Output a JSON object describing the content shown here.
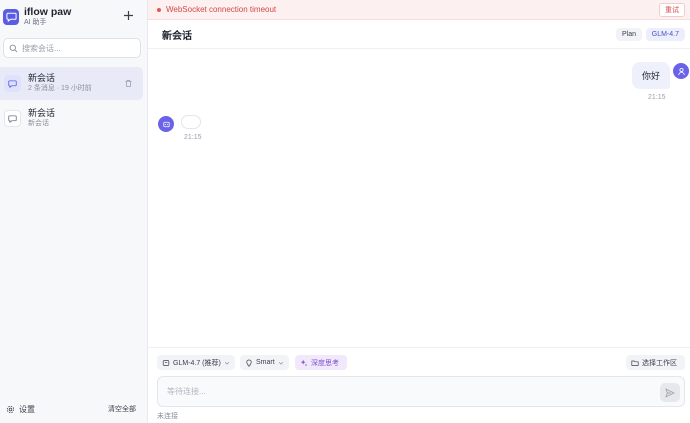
{
  "app": {
    "name": "iflow paw",
    "subtitle": "AI 助手"
  },
  "sidebar": {
    "search_placeholder": "搜索会话...",
    "conversations": [
      {
        "title": "新会话",
        "meta": "2 条消息 · 19 小时前",
        "active": true
      },
      {
        "title": "新会话",
        "meta": "新会话",
        "active": false
      }
    ],
    "settings_label": "设置",
    "clear_all_label": "清空全部"
  },
  "banner": {
    "message": "WebSocket connection timeout",
    "retry_label": "重试"
  },
  "header": {
    "title": "新会话",
    "plan_label": "Plan",
    "model_label": "GLM-4.7"
  },
  "messages": [
    {
      "role": "user",
      "text": "你好",
      "time": "21:15"
    },
    {
      "role": "assistant",
      "text": "",
      "time": "21:15"
    }
  ],
  "composer": {
    "model_chip": "GLM-4.7 (推荐)",
    "mode_chip": "Smart",
    "deep_think_chip": "深度思考",
    "workspace_chip": "选择工作区",
    "input_placeholder": "等待连接...",
    "status": "未连接"
  },
  "colors": {
    "accent": "#6a63e9",
    "error": "#d24a4a",
    "deep_think": "#7b4fd1"
  }
}
